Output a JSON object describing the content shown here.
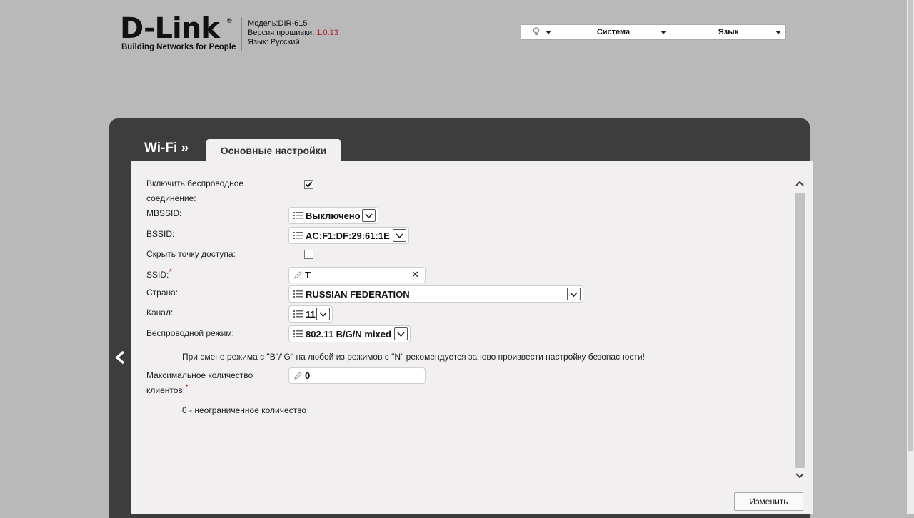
{
  "header": {
    "logo_text": "D-Link",
    "logo_tagline": "Building Networks for People",
    "model_label": "Модель:",
    "model_value": "DIR-615",
    "firmware_label": "Версия прошивки:",
    "firmware_value": "1.0.13",
    "language_label": "Язык:",
    "language_value": "Русский"
  },
  "topbar": {
    "system_label": "Система",
    "language_label": "Язык",
    "icons": [
      "bulb-icon",
      "chevron-down-icon"
    ]
  },
  "page": {
    "section": "Wi-Fi »",
    "tab": "Основные настройки"
  },
  "form": {
    "enable_wireless_label": "Включить беспроводное соединение:",
    "enable_wireless_checked": true,
    "mbssid_label": "MBSSID:",
    "mbssid_value": "Выключено",
    "bssid_label": "BSSID:",
    "bssid_value": "AC:F1:DF:29:61:1E",
    "hide_ap_label": "Скрыть точку доступа:",
    "hide_ap_checked": false,
    "ssid_label": "SSID:",
    "ssid_value": "T",
    "country_label": "Страна:",
    "country_value": "RUSSIAN FEDERATION",
    "channel_label": "Канал:",
    "channel_value": "11",
    "mode_label": "Беспроводной режим:",
    "mode_value": "802.11 B/G/N mixed",
    "mode_hint": "При смене режима с \"B\"/\"G\" на любой из режимов с \"N\" рекомендуется заново произвести настройку безопасности!",
    "max_clients_label": "Максимальное количество клиентов:",
    "max_clients_value": "0",
    "max_clients_hint": "0 - неограниченное количество",
    "required_mark": "*"
  },
  "actions": {
    "apply_label": "Изменить"
  },
  "colors": {
    "panel_bg": "#3d3d3d",
    "content_bg": "#f1efef",
    "page_bg": "#b9b9b9",
    "firmware_link": "#b22222",
    "required": "#c0392b"
  }
}
